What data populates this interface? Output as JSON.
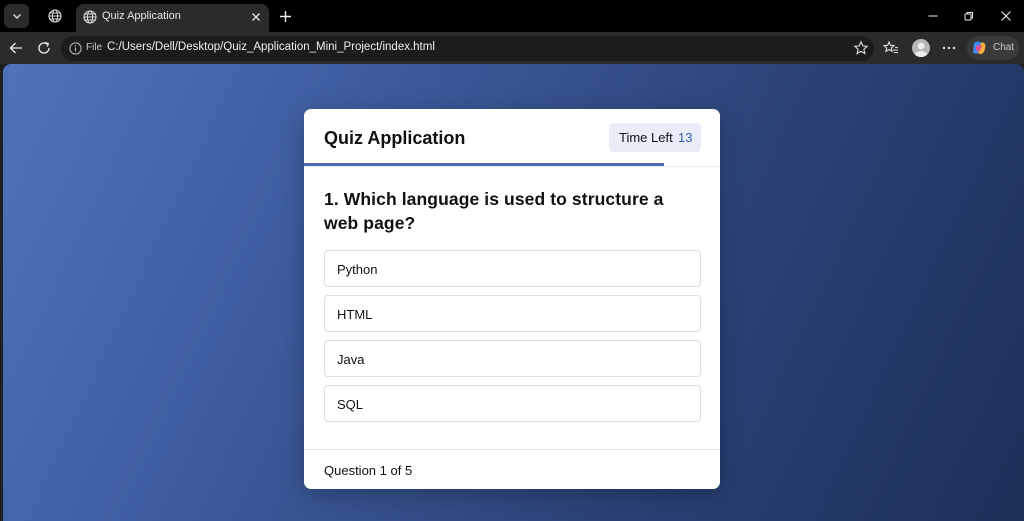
{
  "browser": {
    "tab_title": "Quiz Application",
    "address_label": "File",
    "url": "C:/Users/Dell/Desktop/Quiz_Application_Mini_Project/index.html",
    "chat_label": "Chat"
  },
  "quiz": {
    "title": "Quiz Application",
    "timer_label": "Time Left",
    "timer_value": "13",
    "progress_fraction": 0.865,
    "question": "1. Which language is used to structure a web page?",
    "options": [
      "Python",
      "HTML",
      "Java",
      "SQL"
    ],
    "footer": "Question 1 of 5"
  },
  "colors": {
    "accent": "#4a68b4",
    "timer_bg": "#e8edf7"
  }
}
